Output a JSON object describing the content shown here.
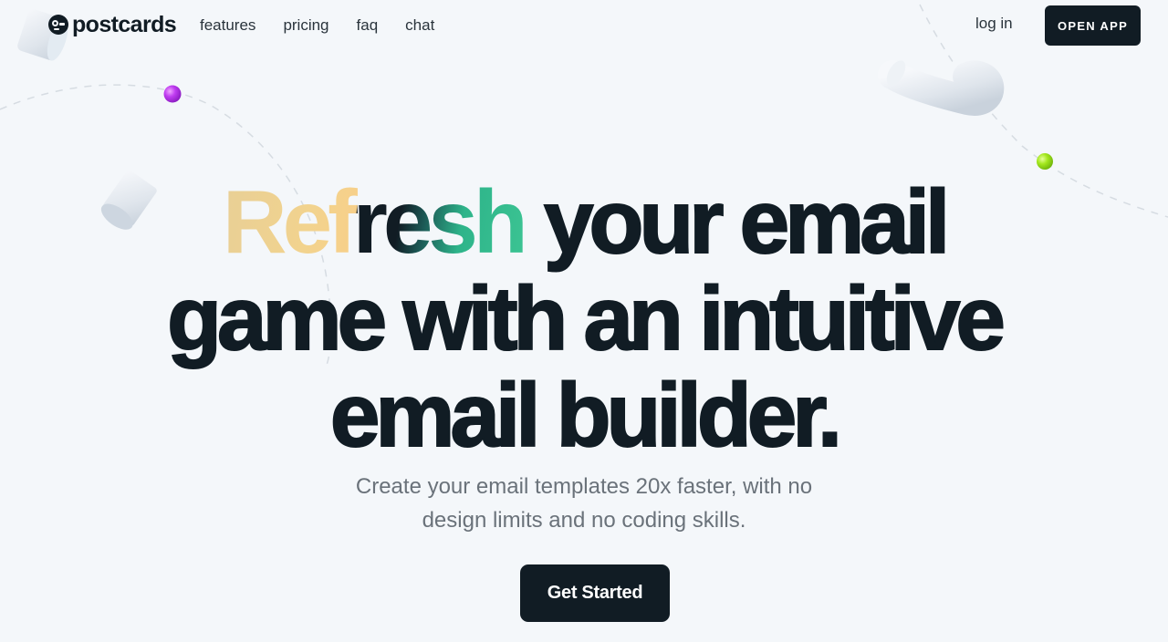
{
  "nav": {
    "logo_text": "postcards",
    "links": [
      {
        "label": "features"
      },
      {
        "label": "pricing"
      },
      {
        "label": "faq"
      },
      {
        "label": "chat"
      }
    ],
    "login_label": "log in",
    "open_app_label": "OPEN APP"
  },
  "hero": {
    "title_highlight": "Refresh",
    "title_line1_rest": " your email",
    "title_line2": "game with an intuitive",
    "title_line3": "email builder.",
    "subtitle_line1": "Create your email templates 20x faster, with no",
    "subtitle_line2": "design limits and no coding skills.",
    "cta_label": "Get Started"
  },
  "colors": {
    "background": "#f4f7fa",
    "primary_dark": "#111c24",
    "highlight_gold": "#f2d38e",
    "highlight_green": "#3cc493",
    "ball_purple": "#b23be8",
    "ball_green": "#9be01a"
  }
}
